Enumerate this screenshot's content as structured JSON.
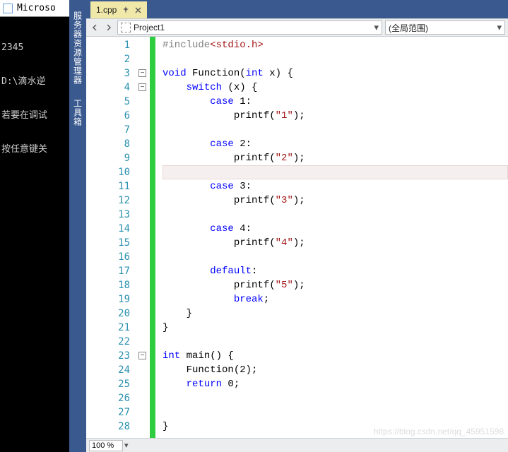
{
  "console": {
    "title": "Microso",
    "lines": [
      "2345",
      "D:\\滴水逆",
      "若要在调试",
      "按任意键关"
    ]
  },
  "sidestrip": {
    "tabs": [
      "服务器资源管理器",
      "工具箱"
    ]
  },
  "doc_tab": {
    "label": "1.cpp"
  },
  "nav": {
    "scope": "Project1",
    "scope2": "(全局范围)"
  },
  "zoom": {
    "value": "100 %"
  },
  "watermark": "https://blog.csdn.net/qq_45951598",
  "code": {
    "lines": [
      {
        "n": 1,
        "t": [
          {
            "c": "pp",
            "s": "#include"
          },
          {
            "c": "inc-path",
            "s": "<stdio.h>"
          }
        ]
      },
      {
        "n": 2,
        "t": []
      },
      {
        "n": 3,
        "fold": true,
        "t": [
          {
            "c": "kw",
            "s": "void"
          },
          {
            "s": " Function("
          },
          {
            "c": "kw",
            "s": "int"
          },
          {
            "s": " x) {"
          }
        ]
      },
      {
        "n": 4,
        "fold": true,
        "t": [
          {
            "s": "    "
          },
          {
            "c": "kw",
            "s": "switch"
          },
          {
            "s": " (x) {"
          }
        ]
      },
      {
        "n": 5,
        "t": [
          {
            "s": "        "
          },
          {
            "c": "kw",
            "s": "case"
          },
          {
            "s": " 1:"
          }
        ]
      },
      {
        "n": 6,
        "t": [
          {
            "s": "            printf("
          },
          {
            "c": "str",
            "s": "\"1\""
          },
          {
            "s": ");"
          }
        ]
      },
      {
        "n": 7,
        "t": []
      },
      {
        "n": 8,
        "t": [
          {
            "s": "        "
          },
          {
            "c": "kw",
            "s": "case"
          },
          {
            "s": " 2:"
          }
        ]
      },
      {
        "n": 9,
        "t": [
          {
            "s": "            printf("
          },
          {
            "c": "str",
            "s": "\"2\""
          },
          {
            "s": ");"
          }
        ]
      },
      {
        "n": 10,
        "hl": true,
        "t": []
      },
      {
        "n": 11,
        "t": [
          {
            "s": "        "
          },
          {
            "c": "kw",
            "s": "case"
          },
          {
            "s": " 3:"
          }
        ]
      },
      {
        "n": 12,
        "t": [
          {
            "s": "            printf("
          },
          {
            "c": "str",
            "s": "\"3\""
          },
          {
            "s": ");"
          }
        ]
      },
      {
        "n": 13,
        "t": []
      },
      {
        "n": 14,
        "t": [
          {
            "s": "        "
          },
          {
            "c": "kw",
            "s": "case"
          },
          {
            "s": " 4:"
          }
        ]
      },
      {
        "n": 15,
        "t": [
          {
            "s": "            printf("
          },
          {
            "c": "str",
            "s": "\"4\""
          },
          {
            "s": ");"
          }
        ]
      },
      {
        "n": 16,
        "t": []
      },
      {
        "n": 17,
        "t": [
          {
            "s": "        "
          },
          {
            "c": "kw",
            "s": "default"
          },
          {
            "s": ":"
          }
        ]
      },
      {
        "n": 18,
        "t": [
          {
            "s": "            printf("
          },
          {
            "c": "str",
            "s": "\"5\""
          },
          {
            "s": ");"
          }
        ]
      },
      {
        "n": 19,
        "t": [
          {
            "s": "            "
          },
          {
            "c": "kw",
            "s": "break"
          },
          {
            "s": ";"
          }
        ]
      },
      {
        "n": 20,
        "t": [
          {
            "s": "    }"
          }
        ]
      },
      {
        "n": 21,
        "t": [
          {
            "s": "}"
          }
        ]
      },
      {
        "n": 22,
        "t": []
      },
      {
        "n": 23,
        "fold": true,
        "t": [
          {
            "c": "kw",
            "s": "int"
          },
          {
            "s": " main() {"
          }
        ]
      },
      {
        "n": 24,
        "t": [
          {
            "s": "    Function(2);"
          }
        ]
      },
      {
        "n": 25,
        "t": [
          {
            "s": "    "
          },
          {
            "c": "kw",
            "s": "return"
          },
          {
            "s": " 0;"
          }
        ]
      },
      {
        "n": 26,
        "t": []
      },
      {
        "n": 27,
        "t": []
      },
      {
        "n": 28,
        "t": [
          {
            "s": "}"
          }
        ]
      }
    ]
  }
}
